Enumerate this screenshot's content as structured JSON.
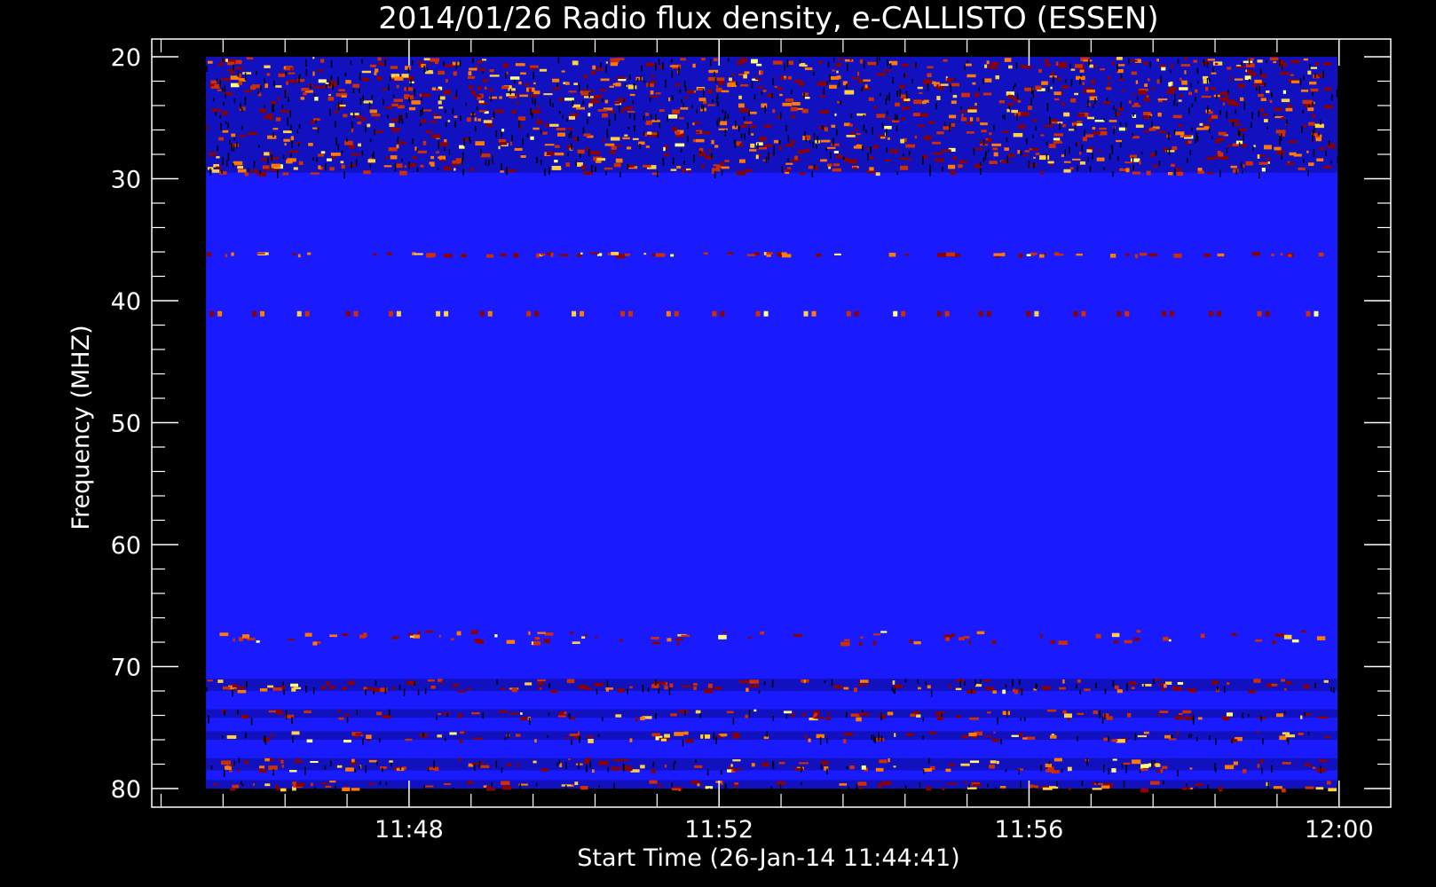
{
  "chart_data": {
    "type": "heatmap",
    "title": "2014/01/26  Radio flux density, e-CALLISTO (ESSEN)",
    "xlabel": "Start Time (26-Jan-14 11:44:41)",
    "ylabel": "Frequency (MHZ)",
    "y_axis": {
      "range": [
        20,
        80
      ],
      "inverted": true,
      "major_ticks": [
        20,
        30,
        40,
        50,
        60,
        70,
        80
      ],
      "minor_step": 2
    },
    "x_axis": {
      "range_minutes_after_start": [
        0,
        15.3
      ],
      "major_ticks": [
        {
          "label": "11:48",
          "minutes_after_start": 3.32
        },
        {
          "label": "11:52",
          "minutes_after_start": 7.32
        },
        {
          "label": "11:56",
          "minutes_after_start": 11.32
        },
        {
          "label": "12:00",
          "minutes_after_start": 15.32
        }
      ],
      "minor_ticks_per_major": 5
    },
    "data_window_minutes": [
      0.7,
      15.3
    ],
    "colors": {
      "background": "#000000",
      "low_intensity": "#1a1aff",
      "axes": "#ffffff",
      "hot": [
        "#8b0000",
        "#d03000",
        "#ff7a00",
        "#ffd040",
        "#ffff80"
      ]
    },
    "intensity_bands": [
      {
        "freq_mhz": [
          20,
          29.5
        ],
        "level": "high",
        "note": "broadband interference"
      },
      {
        "freq_mhz": [
          36,
          36.2
        ],
        "level": "medium"
      },
      {
        "freq_mhz": [
          41,
          41.2
        ],
        "level": "periodic",
        "note": "regular bursts"
      },
      {
        "freq_mhz": [
          67,
          68
        ],
        "level": "medium"
      },
      {
        "freq_mhz": [
          71,
          72
        ],
        "level": "high"
      },
      {
        "freq_mhz": [
          73.5,
          74.2
        ],
        "level": "high"
      },
      {
        "freq_mhz": [
          75.3,
          76
        ],
        "level": "high"
      },
      {
        "freq_mhz": [
          77.5,
          78.5
        ],
        "level": "high"
      },
      {
        "freq_mhz": [
          79.3,
          80
        ],
        "level": "high"
      }
    ]
  }
}
